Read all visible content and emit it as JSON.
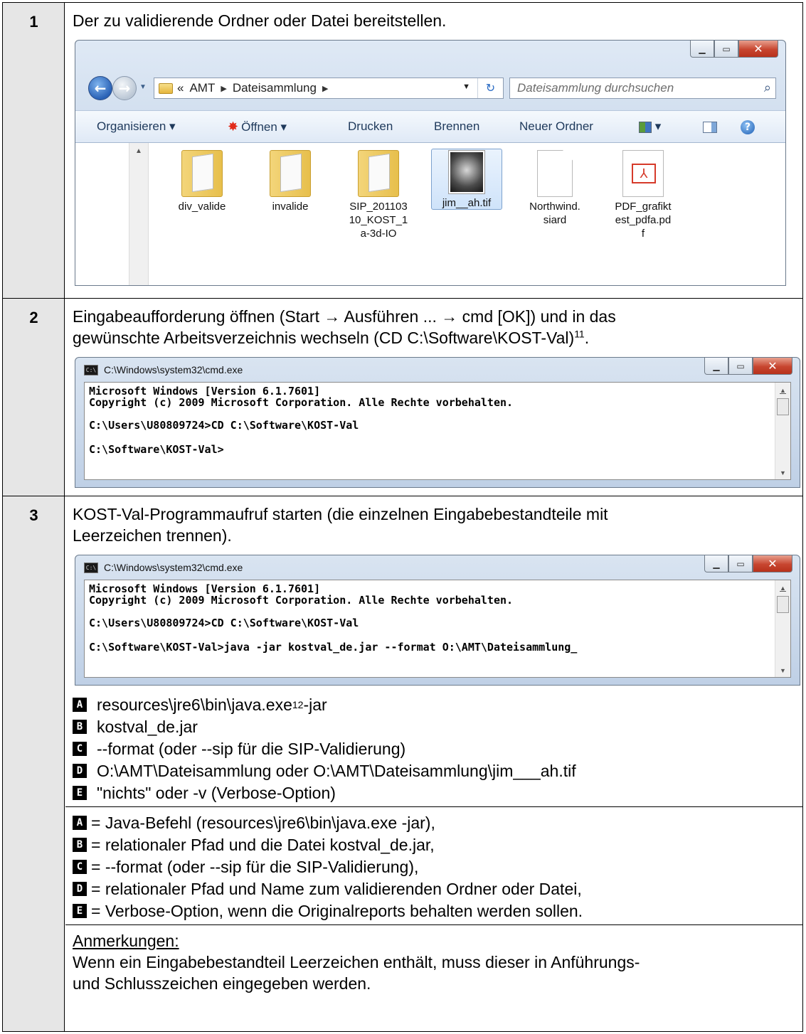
{
  "rows": [
    {
      "num": "1",
      "text": "Der zu validierende Ordner oder Datei bereitstellen.",
      "explorer": {
        "address_overflow": "«",
        "address_segments": [
          "AMT",
          "Dateisammlung"
        ],
        "search_placeholder": "Dateisammlung durchsuchen",
        "commands": [
          "Organisieren ▾",
          "Öffnen ▾",
          "Drucken",
          "Brennen",
          "Neuer Ordner"
        ],
        "files": [
          {
            "name1": "div_valide",
            "name2": "",
            "name3": "",
            "type": "folder"
          },
          {
            "name1": "invalide",
            "name2": "",
            "name3": "",
            "type": "folder"
          },
          {
            "name1": "SIP_201103",
            "name2": "10_KOST_1",
            "name3": "a-3d-IO",
            "type": "folder"
          },
          {
            "name1": "jim__ah.tif",
            "name2": "",
            "name3": "",
            "type": "image",
            "selected": true
          },
          {
            "name1": "Northwind.",
            "name2": "siard",
            "name3": "",
            "type": "file"
          },
          {
            "name1": "PDF_grafikt",
            "name2": "est_pdfa.pd",
            "name3": "f",
            "type": "pdf"
          }
        ]
      }
    },
    {
      "num": "2",
      "text1": "Eingabeaufforderung öffnen (Start → Ausführen ... → cmd [OK]) und in das",
      "text2": "gewünschte Arbeitsverzeichnis wechseln (CD C:\\Software\\KOST-Val)",
      "footnote": "11",
      "text2_end": ".",
      "console": {
        "title": "C:\\Windows\\system32\\cmd.exe",
        "lines": [
          "Microsoft Windows [Version 6.1.7601]",
          "Copyright (c) 2009 Microsoft Corporation. Alle Rechte vorbehalten.",
          "C:\\Users\\U80809724>CD C:\\Software\\KOST-Val",
          "C:\\Software\\KOST-Val>"
        ]
      }
    },
    {
      "num": "3",
      "text1": "KOST-Val-Programmaufruf starten (die einzelnen Eingabebestandteile mit",
      "text2": "Leerzeichen trennen).",
      "console": {
        "title": "C:\\Windows\\system32\\cmd.exe",
        "lines": [
          "Microsoft Windows [Version 6.1.7601]",
          "Copyright (c) 2009 Microsoft Corporation. Alle Rechte vorbehalten.",
          "C:\\Users\\U80809724>CD C:\\Software\\KOST-Val",
          "C:\\Software\\KOST-Val>java -jar kostval_de.jar --format O:\\AMT\\Dateisammlung_"
        ]
      },
      "parts": [
        {
          "letter": "A",
          "text": "resources\\jre6\\bin\\java.exe",
          "sup": "12",
          "after": " -jar"
        },
        {
          "letter": "B",
          "text": "kostval_de.jar"
        },
        {
          "letter": "C",
          "text": "--format (oder --sip für die SIP-Validierung)"
        },
        {
          "letter": "D",
          "text": "O:\\AMT\\Dateisammlung oder O:\\AMT\\Dateisammlung\\jim___ah.tif"
        },
        {
          "letter": "E",
          "text": "\"nichts\" oder -v (Verbose-Option)"
        }
      ],
      "legend": [
        {
          "letter": "A",
          "text": "= Java-Befehl (resources\\jre6\\bin\\java.exe -jar),"
        },
        {
          "letter": "B",
          "text": "= relationaler Pfad und die Datei kostval_de.jar,"
        },
        {
          "letter": "C",
          "text": "= --format (oder --sip für die SIP-Validierung),"
        },
        {
          "letter": "D",
          "text": "= relationaler Pfad und Name zum validierenden Ordner oder Datei,"
        },
        {
          "letter": "E",
          "text": "= Verbose-Option, wenn die Originalreports behalten werden sollen."
        }
      ],
      "notes_heading": "Anmerkungen:",
      "notes1": "Wenn ein Eingabebestandteil Leerzeichen enthält, muss dieser in Anführungs-",
      "notes2": "und Schlusszeichen eingegeben werden."
    }
  ]
}
